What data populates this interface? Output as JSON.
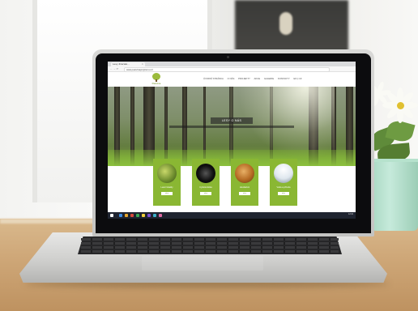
{
  "browser": {
    "tab_title": "Lesy Jizerské...",
    "tab_close": "×",
    "url": "www.pastvinaprojizerou.cz",
    "nav": "← → ⟳"
  },
  "site": {
    "logo_text": "Pastvina",
    "menu": [
      "ÚVODNÍ STRÁNKA",
      "O NÁS",
      "PROJEKTY",
      "AKCE",
      "GALERIE",
      "KONTAKTY",
      "EN | CZ"
    ],
    "hero_title": "LESY O NÁS",
    "cards": [
      {
        "label": "Lesní lokality",
        "button": "více",
        "photo_color": "#8aa24c"
      },
      {
        "label": "Cykloturistika",
        "button": "více",
        "photo_color": "#1c1c1c"
      },
      {
        "label": "Houbaření",
        "button": "více",
        "photo_color": "#c07a2c"
      },
      {
        "label": "Voda a příroda",
        "button": "více",
        "photo_color": "#e8eef2"
      }
    ]
  },
  "taskbar": {
    "clock": "12:04",
    "icon_colors": [
      "#3d8ee6",
      "#e8a72c",
      "#d94b3c",
      "#39a853",
      "#f2d13c",
      "#7d4fd6",
      "#3bb0c9",
      "#e06aa3"
    ]
  },
  "colors": {
    "accent": "#8ab733",
    "wood": "#cfa879",
    "pot": "#b6e2cd"
  }
}
